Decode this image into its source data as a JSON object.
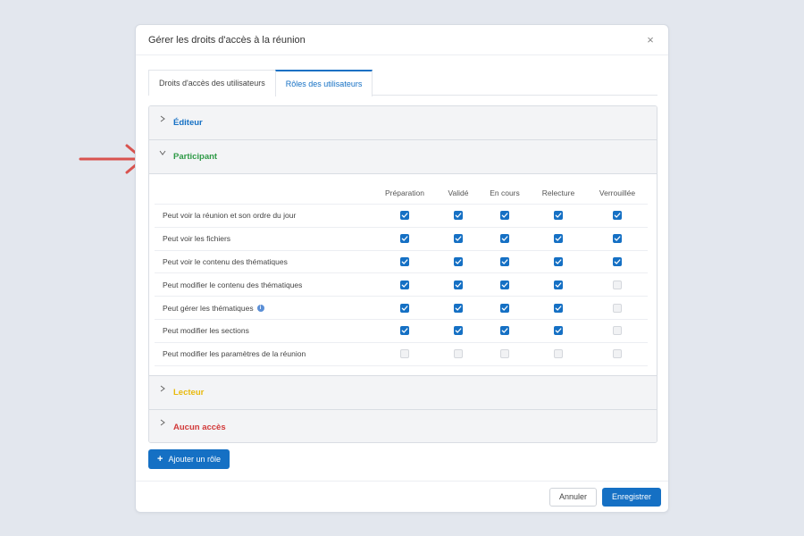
{
  "modal": {
    "title": "Gérer les droits d'accès à la réunion",
    "close_icon": "×"
  },
  "tabs": [
    {
      "label": "Droits d'accès des utilisateurs",
      "active": false
    },
    {
      "label": "Rôles des utilisateurs",
      "active": true
    }
  ],
  "roles": {
    "editor": {
      "name": "Éditeur",
      "color": "#1570c4",
      "expanded": false
    },
    "participant": {
      "name": "Participant",
      "color": "#2f9a47",
      "expanded": true
    },
    "reader": {
      "name": "Lecteur",
      "color": "#e8b90c",
      "expanded": false
    },
    "none": {
      "name": "Aucun accès",
      "color": "#d23a3a",
      "expanded": false
    }
  },
  "permissions": {
    "columns": [
      "Préparation",
      "Validé",
      "En cours",
      "Relecture",
      "Verrouillée"
    ],
    "rows": [
      {
        "label": "Peut voir la réunion et son ordre du jour",
        "info": false,
        "checks": [
          true,
          true,
          true,
          true,
          true
        ]
      },
      {
        "label": "Peut voir les fichiers",
        "info": false,
        "checks": [
          true,
          true,
          true,
          true,
          true
        ]
      },
      {
        "label": "Peut voir le contenu des thématiques",
        "info": false,
        "checks": [
          true,
          true,
          true,
          true,
          true
        ]
      },
      {
        "label": "Peut modifier le contenu des thématiques",
        "info": false,
        "checks": [
          true,
          true,
          true,
          true,
          false
        ]
      },
      {
        "label": "Peut gérer les thématiques",
        "info": true,
        "checks": [
          true,
          true,
          true,
          true,
          false
        ]
      },
      {
        "label": "Peut modifier les sections",
        "info": false,
        "checks": [
          true,
          true,
          true,
          true,
          false
        ]
      },
      {
        "label": "Peut modifier les paramètres de la réunion",
        "info": false,
        "checks": [
          false,
          false,
          false,
          false,
          false
        ]
      }
    ]
  },
  "actions": {
    "add_role_label": "Ajouter un rôle",
    "cancel_label": "Annuler",
    "save_label": "Enregistrer"
  },
  "colors": {
    "accent": "#1570c4",
    "arrow": "#d9534f"
  }
}
